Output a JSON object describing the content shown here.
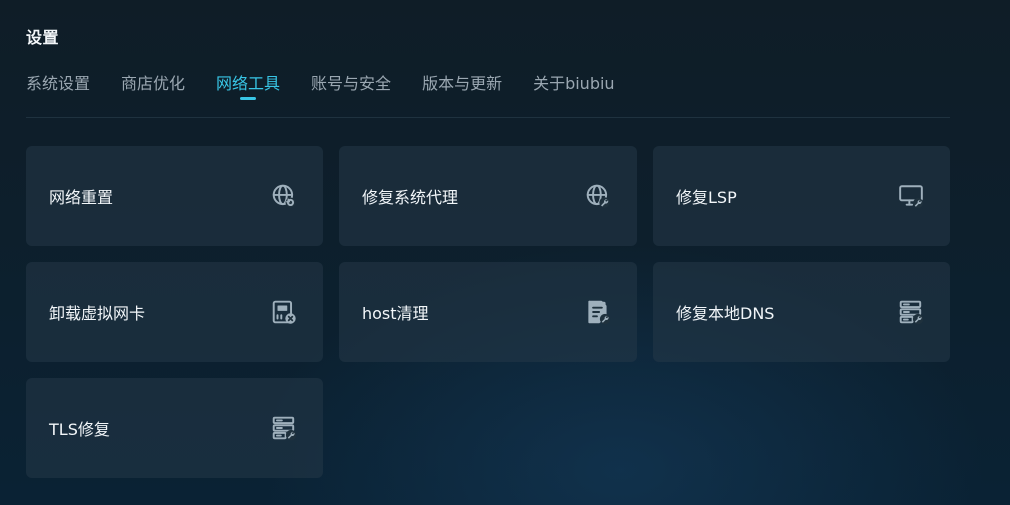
{
  "header": {
    "title": "设置"
  },
  "tabs": [
    {
      "label": "系统设置",
      "active": false
    },
    {
      "label": "商店优化",
      "active": false
    },
    {
      "label": "网络工具",
      "active": true
    },
    {
      "label": "账号与安全",
      "active": false
    },
    {
      "label": "版本与更新",
      "active": false
    },
    {
      "label": "关于biubiu",
      "active": false
    }
  ],
  "tools": [
    {
      "label": "网络重置",
      "icon": "globe-refresh-icon"
    },
    {
      "label": "修复系统代理",
      "icon": "globe-wrench-icon"
    },
    {
      "label": "修复LSP",
      "icon": "monitor-wrench-icon"
    },
    {
      "label": "卸载虚拟网卡",
      "icon": "network-card-remove-icon"
    },
    {
      "label": "host清理",
      "icon": "document-wrench-icon"
    },
    {
      "label": "修复本地DNS",
      "icon": "server-wrench-icon"
    },
    {
      "label": "TLS修复",
      "icon": "server-wrench-icon"
    }
  ],
  "colors": {
    "accent": "#38c6e6",
    "tab_inactive": "#9aa7b1",
    "card_bg": "#1d2f3b",
    "icon": "#9fb0bc",
    "background": "#0d1f2c"
  }
}
